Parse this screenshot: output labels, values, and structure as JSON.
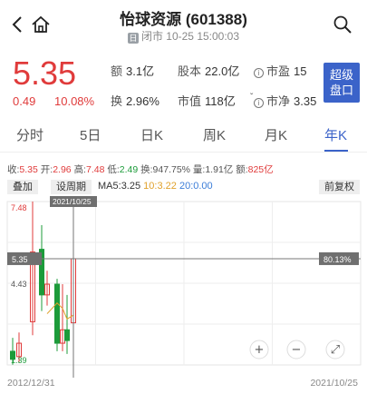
{
  "header": {
    "title": "怡球资源 (601388)",
    "market_icon": "日",
    "subtitle": "闭市 10-25 15:00:03"
  },
  "quote": {
    "price": "5.35",
    "change": "0.49",
    "change_pct": "10.08%",
    "amount_label": "额",
    "amount": "3.1亿",
    "turnover_label": "换",
    "turnover": "2.96%",
    "equity_label": "股本",
    "equity": "22.0亿",
    "mcap_label": "市值",
    "mcap": "118亿",
    "tick": "ˇ",
    "pe_label": "市盈",
    "pe": "15",
    "pb_label": "市净",
    "pb": "3.35",
    "info_icon": "i",
    "super_button": [
      "超级",
      "盘口"
    ]
  },
  "tabs": [
    {
      "label": "分时",
      "active": false
    },
    {
      "label": "5日",
      "active": false
    },
    {
      "label": "日K",
      "active": false
    },
    {
      "label": "周K",
      "active": false
    },
    {
      "label": "月K",
      "active": false
    },
    {
      "label": "年K",
      "active": true
    }
  ],
  "stats": {
    "close_label": "收:",
    "close": "5.35",
    "open_label": "开:",
    "open": "2.96",
    "high_label": "高:",
    "high": "7.48",
    "low_label": "低:",
    "low": "2.49",
    "turnover_label": "换:",
    "turnover": "947.75%",
    "volume_label": "量:",
    "volume": "1.91亿",
    "amount_label": "额:",
    "amount": "825亿"
  },
  "toolbar": {
    "overlay": "叠加",
    "period": "设周期",
    "ma5_label": "MA5:",
    "ma5": "3.25",
    "ma10_label": "10:",
    "ma10": "3.22",
    "ma20_label": "20:",
    "ma20": "0.00",
    "adjust": "前复权"
  },
  "chart_data": {
    "type": "candlestick",
    "y_max_label": "7.48",
    "y_mid_label": "4.43",
    "y_min_label": "1.39",
    "ylim": [
      1.39,
      7.48
    ],
    "current_price_label": "5.35",
    "current_price": 5.35,
    "crosshair_date": "2021/10/25",
    "current_pct_label": "80.13%",
    "x_start": "2012/12/31",
    "x_end": "2021/10/25",
    "candles": [
      {
        "open": 1.9,
        "close": 1.6,
        "high": 2.4,
        "low": 1.4
      },
      {
        "open": 1.7,
        "close": 2.2,
        "high": 2.6,
        "low": 1.5
      },
      {
        "open": 3.0,
        "close": 5.6,
        "high": 7.48,
        "low": 2.5
      },
      {
        "open": 5.7,
        "close": 4.0,
        "high": 6.6,
        "low": 3.4
      },
      {
        "open": 4.0,
        "close": 4.4,
        "high": 4.9,
        "low": 3.6
      },
      {
        "open": 4.4,
        "close": 2.2,
        "high": 4.6,
        "low": 1.9
      },
      {
        "open": 2.2,
        "close": 2.7,
        "high": 4.4,
        "low": 1.9
      },
      {
        "open": 2.7,
        "close": 2.3,
        "high": 4.0,
        "low": 1.8
      },
      {
        "open": 2.96,
        "close": 5.35,
        "high": 5.4,
        "low": 2.49
      }
    ],
    "ma5": [
      null,
      null,
      null,
      null,
      3.3,
      3.7,
      3.5,
      3.1,
      3.25
    ]
  },
  "zoom": {
    "in_icon": "+",
    "out_icon": "−",
    "expand_icon": "⤢"
  },
  "colors": {
    "up": "#e03b3b",
    "down": "#1c9b3a",
    "accent": "#3b63c9"
  }
}
